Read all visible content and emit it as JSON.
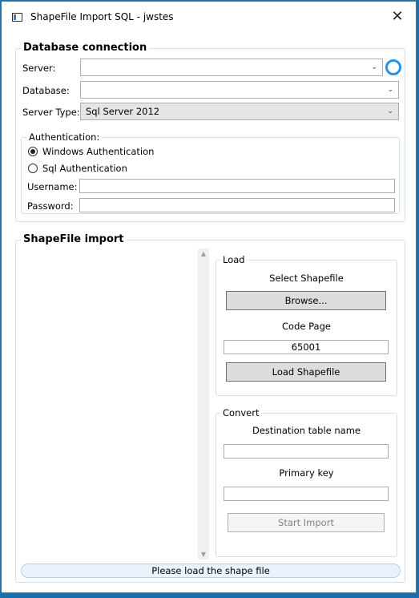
{
  "window": {
    "title": "ShapeFile Import SQL - jwstes",
    "close_icon": "close-icon"
  },
  "database_connection": {
    "header": "Database connection",
    "server_label": "Server:",
    "server_value": "",
    "database_label": "Database:",
    "database_value": "",
    "server_type_label": "Server Type:",
    "server_type_value": "Sql Server 2012",
    "refresh_icon": "loading-ring-icon",
    "authentication": {
      "header": "Authentication:",
      "windows_auth_label": "Windows Authentication",
      "windows_auth_checked": true,
      "sql_auth_label": "Sql Authentication",
      "sql_auth_checked": false,
      "username_label": "Username:",
      "username_value": "",
      "password_label": "Password:",
      "password_value": ""
    }
  },
  "shapefile_import": {
    "header": "ShapeFile import",
    "load": {
      "header": "Load",
      "select_label": "Select Shapefile",
      "browse_button": "Browse...",
      "code_page_label": "Code Page",
      "code_page_value": "65001",
      "load_button": "Load Shapefile"
    },
    "convert": {
      "header": "Convert",
      "dest_table_label": "Destination table name",
      "dest_table_value": "",
      "primary_key_label": "Primary key",
      "primary_key_value": "",
      "start_import_button": "Start Import"
    }
  },
  "status": {
    "message": "Please load the shape file"
  },
  "colors": {
    "accent": "#2a92e8",
    "window_border": "#2b79c9",
    "desktop": "#1b6fa8"
  }
}
